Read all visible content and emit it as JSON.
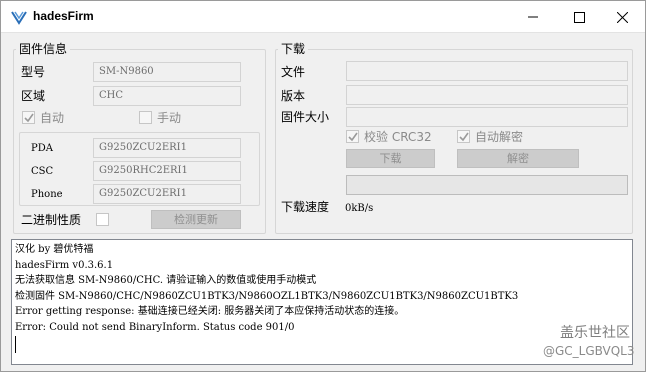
{
  "window": {
    "title": "hadesFirm",
    "minimize_icon": "minimize-icon",
    "maximize_icon": "maximize-icon",
    "close_icon": "close-icon"
  },
  "firmware_info": {
    "legend": "固件信息",
    "model_label": "型号",
    "model_value": "SM-N9860",
    "region_label": "区域",
    "region_value": "CHC",
    "auto_label": "自动",
    "auto_checked": true,
    "manual_label": "手动",
    "manual_checked": false,
    "pda_label": "PDA",
    "pda_value": "G9250ZCU2ERI1",
    "csc_label": "CSC",
    "csc_value": "G9250RHC2ERI1",
    "phone_label": "Phone",
    "phone_value": "G9250ZCU2ERI1",
    "binary_label": "二进制性质",
    "binary_checked": false,
    "check_update_button": "检测更新"
  },
  "download": {
    "legend": "下载",
    "file_label": "文件",
    "file_value": "",
    "version_label": "版本",
    "version_value": "",
    "size_label": "固件大小",
    "size_value": "",
    "verify_label": "校验 CRC32",
    "verify_checked": true,
    "auto_decrypt_label": "自动解密",
    "auto_decrypt_checked": true,
    "download_button": "下载",
    "decrypt_button": "解密",
    "progress": 0,
    "speed_label": "下载速度",
    "speed_value": "0kB/s"
  },
  "log": {
    "lines": [
      "汉化 by 碧优特福",
      "hadesFirm v0.3.6.1",
      "无法获取信息 SM-N9860/CHC. 请验证输入的数值或使用手动模式",
      "检测固件 SM-N9860/CHC/N9860ZCU1BTK3/N9860OZL1BTK3/N9860ZCU1BTK3/N9860ZCU1BTK3",
      "Error getting response: 基础连接已经关闭: 服务器关闭了本应保持活动状态的连接。",
      "Error: Could not send BinaryInform. Status code 901/0"
    ]
  },
  "watermark": {
    "line1": "盖乐世社区",
    "line2": "@GC_LGBVQL3"
  },
  "colors": {
    "window_bg": "#f0f0f0",
    "field_border": "#d3d3d3",
    "button_bg": "#cccccc"
  }
}
